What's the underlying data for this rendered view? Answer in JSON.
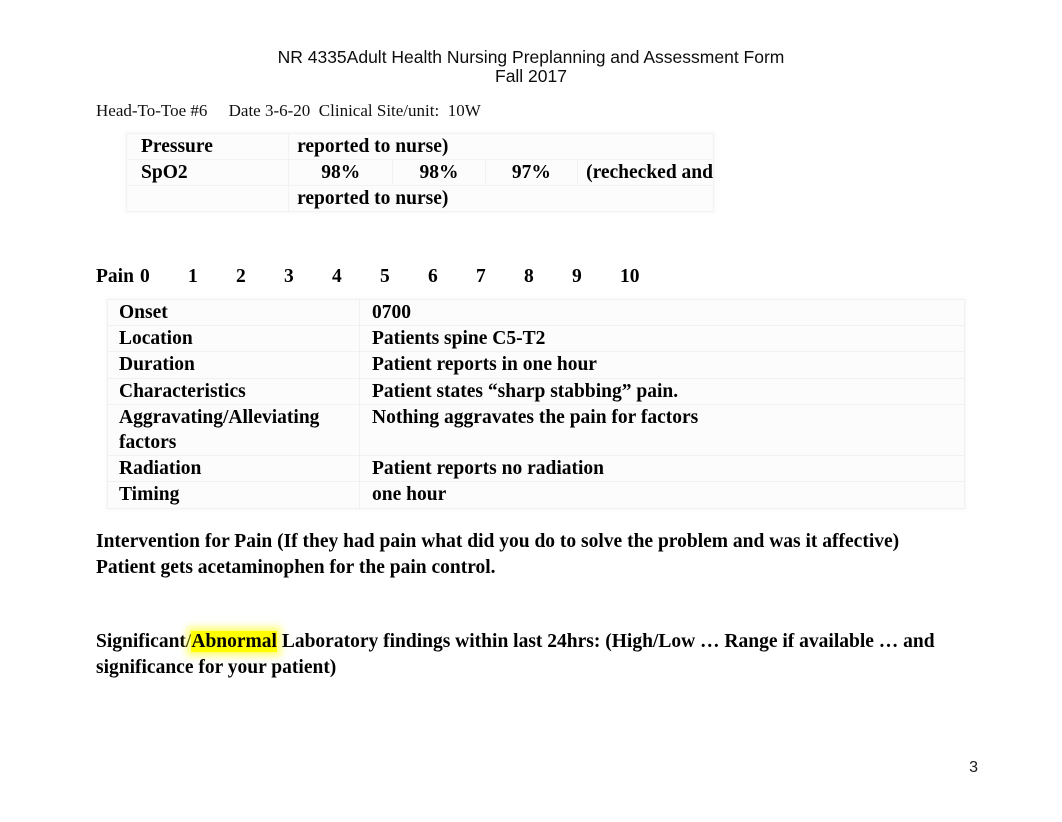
{
  "document": {
    "title_line1": "NR 4335Adult Health Nursing Preplanning and Assessment Form",
    "title_line2": "Fall 2017",
    "meta_line": "Head-To-Toe #6     Date 3-6-20  Clinical Site/unit:  10W",
    "page_number": "3"
  },
  "vitals_table": {
    "rows": [
      {
        "label": "Pressure",
        "c1": "",
        "c2": "",
        "c3": "",
        "c4": "reported to nurse)"
      },
      {
        "label": "SpO2",
        "c1": "98%",
        "c2": "98%",
        "c3": "97%",
        "c4": "(rechecked and"
      },
      {
        "label": "",
        "c1": "",
        "c2": "",
        "c3": "",
        "c4": "reported to nurse)"
      }
    ]
  },
  "pain_scale": {
    "label": "Pain",
    "values": [
      "0",
      "1",
      "2",
      "3",
      "4",
      "5",
      "6",
      "7",
      "8",
      "9",
      "10"
    ]
  },
  "pain_table": {
    "rows": [
      {
        "label": "Onset",
        "value": "0700"
      },
      {
        "label": "Location",
        "value": "Patients spine C5-T2"
      },
      {
        "label": "Duration",
        "value": "Patient reports in one hour"
      },
      {
        "label": "Characteristics",
        "value": "Patient states “sharp stabbing” pain."
      },
      {
        "label": "Aggravating/Alleviating factors",
        "value": "Nothing aggravates the pain for factors"
      },
      {
        "label": "Radiation",
        "value": "Patient reports no radiation"
      },
      {
        "label": "Timing",
        "value": "one hour"
      }
    ]
  },
  "intervention": {
    "prompt": "Intervention for Pain (If they had pain what did you do to solve the problem and was it affective)",
    "answer": "Patient gets acetaminophen for the pain control."
  },
  "labs": {
    "prefix": "Significant/",
    "highlight": "Abnormal",
    "suffix": " Laboratory findings within last 24hrs:  (High/Low … Range if available … and significance for your patient)"
  },
  "colors": {
    "highlight": "#FFFF00",
    "text": "#000000",
    "page_background": "#FFFFFF"
  }
}
